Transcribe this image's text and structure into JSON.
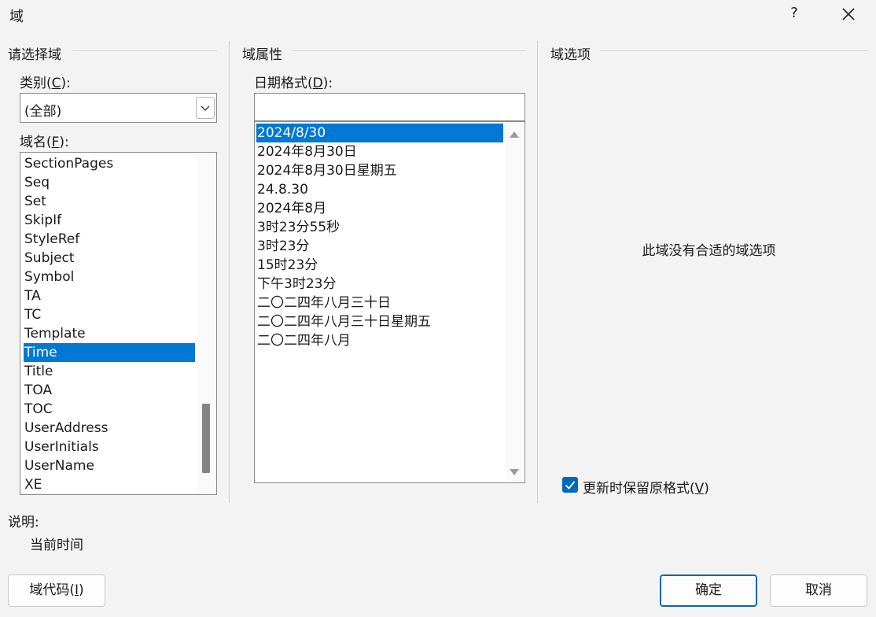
{
  "window": {
    "title": "域",
    "help_label": "?",
    "close_icon": "close-icon"
  },
  "left_panel": {
    "group_title": "请选择域",
    "category_label": "类别(",
    "category_accel": "C",
    "category_label_end": "):",
    "category_value": "(全部)",
    "field_label": "域名(",
    "field_accel": "F",
    "field_label_end": "):",
    "fields": [
      "SectionPages",
      "Seq",
      "Set",
      "SkipIf",
      "StyleRef",
      "Subject",
      "Symbol",
      "TA",
      "TC",
      "Template",
      "Time",
      "Title",
      "TOA",
      "TOC",
      "UserAddress",
      "UserInitials",
      "UserName",
      "XE"
    ],
    "selected_field": "Time"
  },
  "middle_panel": {
    "group_title": "域属性",
    "date_format_label": "日期格式(",
    "date_format_accel": "D",
    "date_format_label_end": "):",
    "date_format_value": "",
    "formats": [
      "2024/8/30",
      "2024年8月30日",
      "2024年8月30日星期五",
      "24.8.30",
      "2024年8月",
      "3时23分55秒",
      "3时23分",
      "15时23分",
      "下午3时23分",
      "二〇二四年八月三十日",
      "二〇二四年八月三十日星期五",
      "二〇二四年八月"
    ],
    "selected_format": "2024/8/30"
  },
  "right_panel": {
    "group_title": "域选项",
    "empty_message": "此域没有合适的域选项",
    "preserve_label": "更新时保留原格式(",
    "preserve_accel": "V",
    "preserve_label_end": ")",
    "preserve_checked": true
  },
  "description": {
    "label": "说明:",
    "text": "当前时间"
  },
  "buttons": {
    "field_codes_label": "域代码(",
    "field_codes_accel": "I",
    "field_codes_end": ")",
    "ok_label": "确定",
    "cancel_label": "取消"
  },
  "colors": {
    "selection": "#0078d4",
    "checkbox": "#0067c0"
  }
}
